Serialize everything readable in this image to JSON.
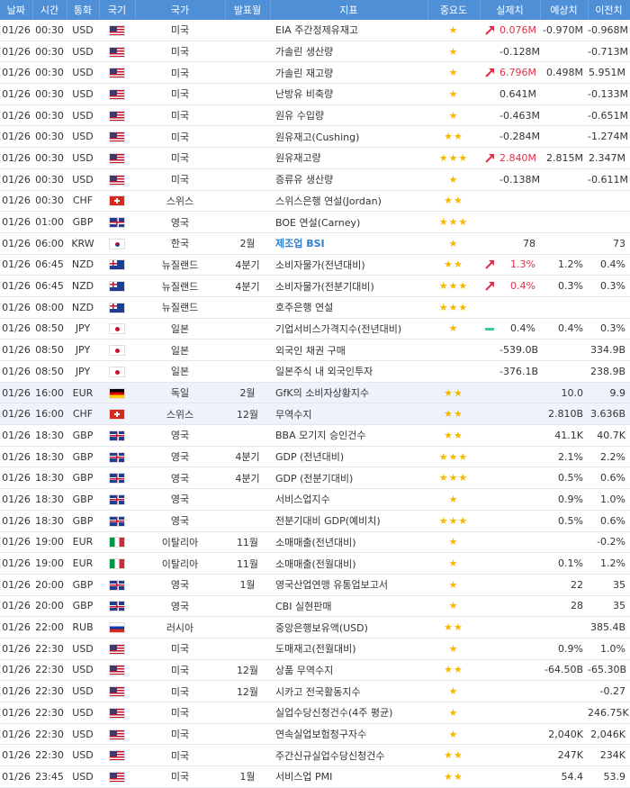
{
  "headers": {
    "date": "날짜",
    "time": "시간",
    "currency": "통화",
    "flag": "국기",
    "country": "국가",
    "period": "발표월",
    "indicator": "지표",
    "importance": "중요도",
    "actual": "실제치",
    "forecast": "예상치",
    "previous": "이전치"
  },
  "rows": [
    {
      "date": "01/26",
      "time": "00:30",
      "cur": "USD",
      "flag": "us",
      "country": "미국",
      "period": "",
      "name": "EIA 주간정제유재고",
      "stars": "★",
      "trend": "up",
      "actual": "0.076M",
      "actual_style": "red",
      "forecast": "-0.970M",
      "previous": "-0.968M"
    },
    {
      "date": "01/26",
      "time": "00:30",
      "cur": "USD",
      "flag": "us",
      "country": "미국",
      "period": "",
      "name": "가솔린 생산량",
      "stars": "★",
      "trend": "",
      "actual": "-0.128M",
      "actual_style": "",
      "forecast": "",
      "previous": "-0.713M"
    },
    {
      "date": "01/26",
      "time": "00:30",
      "cur": "USD",
      "flag": "us",
      "country": "미국",
      "period": "",
      "name": "가솔린 재고량",
      "stars": "★",
      "trend": "up",
      "actual": "6.796M",
      "actual_style": "red",
      "forecast": "0.498M",
      "previous": "5.951M"
    },
    {
      "date": "01/26",
      "time": "00:30",
      "cur": "USD",
      "flag": "us",
      "country": "미국",
      "period": "",
      "name": "난방유 비축량",
      "stars": "★",
      "trend": "",
      "actual": "0.641M",
      "actual_style": "",
      "forecast": "",
      "previous": "-0.133M"
    },
    {
      "date": "01/26",
      "time": "00:30",
      "cur": "USD",
      "flag": "us",
      "country": "미국",
      "period": "",
      "name": "원유 수입량",
      "stars": "★",
      "trend": "",
      "actual": "-0.463M",
      "actual_style": "",
      "forecast": "",
      "previous": "-0.651M"
    },
    {
      "date": "01/26",
      "time": "00:30",
      "cur": "USD",
      "flag": "us",
      "country": "미국",
      "period": "",
      "name": "원유재고(Cushing)",
      "stars": "★★",
      "trend": "",
      "actual": "-0.284M",
      "actual_style": "",
      "forecast": "",
      "previous": "-1.274M"
    },
    {
      "date": "01/26",
      "time": "00:30",
      "cur": "USD",
      "flag": "us",
      "country": "미국",
      "period": "",
      "name": "원유재고량",
      "stars": "★★★",
      "trend": "up",
      "actual": "2.840M",
      "actual_style": "red",
      "forecast": "2.815M",
      "previous": "2.347M"
    },
    {
      "date": "01/26",
      "time": "00:30",
      "cur": "USD",
      "flag": "us",
      "country": "미국",
      "period": "",
      "name": "증류유 생산량",
      "stars": "★",
      "trend": "",
      "actual": "-0.138M",
      "actual_style": "",
      "forecast": "",
      "previous": "-0.611M"
    },
    {
      "date": "01/26",
      "time": "00:30",
      "cur": "CHF",
      "flag": "ch",
      "country": "스위스",
      "period": "",
      "name": "스위스은행 연설(Jordan)",
      "stars": "★★",
      "trend": "",
      "actual": "",
      "actual_style": "",
      "forecast": "",
      "previous": ""
    },
    {
      "date": "01/26",
      "time": "01:00",
      "cur": "GBP",
      "flag": "gb",
      "country": "영국",
      "period": "",
      "name": "BOE 연설(Carney)",
      "stars": "★★★",
      "trend": "",
      "actual": "",
      "actual_style": "",
      "forecast": "",
      "previous": ""
    },
    {
      "date": "01/26",
      "time": "06:00",
      "cur": "KRW",
      "flag": "kr",
      "country": "한국",
      "period": "2월",
      "name": "제조업 BSI",
      "name_style": "blue",
      "stars": "★",
      "trend": "",
      "actual": "78",
      "actual_style": "",
      "forecast": "",
      "previous": "73"
    },
    {
      "date": "01/26",
      "time": "06:45",
      "cur": "NZD",
      "flag": "nz",
      "country": "뉴질랜드",
      "period": "4분기",
      "name": "소비자물가(전년대비)",
      "stars": "★★",
      "trend": "up",
      "actual": "1.3%",
      "actual_style": "red",
      "forecast": "1.2%",
      "previous": "0.4%"
    },
    {
      "date": "01/26",
      "time": "06:45",
      "cur": "NZD",
      "flag": "nz",
      "country": "뉴질랜드",
      "period": "4분기",
      "name": "소비자물가(전분기대비)",
      "stars": "★★★",
      "trend": "up",
      "actual": "0.4%",
      "actual_style": "red",
      "forecast": "0.3%",
      "previous": "0.3%"
    },
    {
      "date": "01/26",
      "time": "08:00",
      "cur": "NZD",
      "flag": "nz",
      "country": "뉴질랜드",
      "period": "",
      "name": "호주은행 연설",
      "stars": "★★★",
      "trend": "",
      "actual": "",
      "actual_style": "",
      "forecast": "",
      "previous": ""
    },
    {
      "date": "01/26",
      "time": "08:50",
      "cur": "JPY",
      "flag": "jp",
      "country": "일본",
      "period": "",
      "name": "기업서비스가격지수(전년대비)",
      "stars": "★",
      "trend": "flat",
      "actual": "0.4%",
      "actual_style": "",
      "forecast": "0.4%",
      "previous": "0.3%"
    },
    {
      "date": "01/26",
      "time": "08:50",
      "cur": "JPY",
      "flag": "jp",
      "country": "일본",
      "period": "",
      "name": "외국인 채권 구매",
      "stars": "",
      "trend": "",
      "actual": "-539.0B",
      "actual_style": "",
      "forecast": "",
      "previous": "334.9B"
    },
    {
      "date": "01/26",
      "time": "08:50",
      "cur": "JPY",
      "flag": "jp",
      "country": "일본",
      "period": "",
      "name": "일본주식 내 외국인투자",
      "stars": "",
      "trend": "",
      "actual": "-376.1B",
      "actual_style": "",
      "forecast": "",
      "previous": "238.9B"
    },
    {
      "date": "01/26",
      "time": "16:00",
      "cur": "EUR",
      "flag": "de",
      "country": "독일",
      "period": "2월",
      "name": "GfK의 소비자상황지수",
      "stars": "★★",
      "trend": "",
      "actual": "",
      "actual_style": "",
      "forecast": "10.0",
      "previous": "9.9",
      "highlight": true
    },
    {
      "date": "01/26",
      "time": "16:00",
      "cur": "CHF",
      "flag": "ch",
      "country": "스위스",
      "period": "12월",
      "name": "무역수지",
      "stars": "★★",
      "trend": "",
      "actual": "",
      "actual_style": "",
      "forecast": "2.810B",
      "previous": "3.636B",
      "highlight": true
    },
    {
      "date": "01/26",
      "time": "18:30",
      "cur": "GBP",
      "flag": "gb",
      "country": "영국",
      "period": "",
      "name": "BBA 모기지 승인건수",
      "stars": "★★",
      "trend": "",
      "actual": "",
      "actual_style": "",
      "forecast": "41.1K",
      "previous": "40.7K"
    },
    {
      "date": "01/26",
      "time": "18:30",
      "cur": "GBP",
      "flag": "gb",
      "country": "영국",
      "period": "4분기",
      "name": "GDP (전년대비)",
      "stars": "★★★",
      "trend": "",
      "actual": "",
      "actual_style": "",
      "forecast": "2.1%",
      "previous": "2.2%"
    },
    {
      "date": "01/26",
      "time": "18:30",
      "cur": "GBP",
      "flag": "gb",
      "country": "영국",
      "period": "4분기",
      "name": "GDP (전분기대비)",
      "stars": "★★★",
      "trend": "",
      "actual": "",
      "actual_style": "",
      "forecast": "0.5%",
      "previous": "0.6%"
    },
    {
      "date": "01/26",
      "time": "18:30",
      "cur": "GBP",
      "flag": "gb",
      "country": "영국",
      "period": "",
      "name": "서비스업지수",
      "stars": "★",
      "trend": "",
      "actual": "",
      "actual_style": "",
      "forecast": "0.9%",
      "previous": "1.0%"
    },
    {
      "date": "01/26",
      "time": "18:30",
      "cur": "GBP",
      "flag": "gb",
      "country": "영국",
      "period": "",
      "name": "전분기대비 GDP(예비치)",
      "stars": "★★★",
      "trend": "",
      "actual": "",
      "actual_style": "",
      "forecast": "0.5%",
      "previous": "0.6%"
    },
    {
      "date": "01/26",
      "time": "19:00",
      "cur": "EUR",
      "flag": "it",
      "country": "이탈리아",
      "period": "11월",
      "name": "소매매출(전년대비)",
      "stars": "★",
      "trend": "",
      "actual": "",
      "actual_style": "",
      "forecast": "",
      "previous": "-0.2%"
    },
    {
      "date": "01/26",
      "time": "19:00",
      "cur": "EUR",
      "flag": "it",
      "country": "이탈리아",
      "period": "11월",
      "name": "소매매출(전월대비)",
      "stars": "★",
      "trend": "",
      "actual": "",
      "actual_style": "",
      "forecast": "0.1%",
      "previous": "1.2%"
    },
    {
      "date": "01/26",
      "time": "20:00",
      "cur": "GBP",
      "flag": "gb",
      "country": "영국",
      "period": "1월",
      "name": "영국산업연맹 유통업보고서",
      "stars": "★",
      "trend": "",
      "actual": "",
      "actual_style": "",
      "forecast": "22",
      "previous": "35"
    },
    {
      "date": "01/26",
      "time": "20:00",
      "cur": "GBP",
      "flag": "gb",
      "country": "영국",
      "period": "",
      "name": "CBI 실현판매",
      "stars": "★",
      "trend": "",
      "actual": "",
      "actual_style": "",
      "forecast": "28",
      "previous": "35"
    },
    {
      "date": "01/26",
      "time": "22:00",
      "cur": "RUB",
      "flag": "ru",
      "country": "러시아",
      "period": "",
      "name": "중앙은행보유액(USD)",
      "stars": "★★",
      "trend": "",
      "actual": "",
      "actual_style": "",
      "forecast": "",
      "previous": "385.4B"
    },
    {
      "date": "01/26",
      "time": "22:30",
      "cur": "USD",
      "flag": "us",
      "country": "미국",
      "period": "",
      "name": "도매재고(전월대비)",
      "stars": "★",
      "trend": "",
      "actual": "",
      "actual_style": "",
      "forecast": "0.9%",
      "previous": "1.0%"
    },
    {
      "date": "01/26",
      "time": "22:30",
      "cur": "USD",
      "flag": "us",
      "country": "미국",
      "period": "12월",
      "name": "상품 무역수지",
      "stars": "★★",
      "trend": "",
      "actual": "",
      "actual_style": "",
      "forecast": "-64.50B",
      "previous": "-65.30B"
    },
    {
      "date": "01/26",
      "time": "22:30",
      "cur": "USD",
      "flag": "us",
      "country": "미국",
      "period": "12월",
      "name": "시카고 전국활동지수",
      "stars": "★",
      "trend": "",
      "actual": "",
      "actual_style": "",
      "forecast": "",
      "previous": "-0.27"
    },
    {
      "date": "01/26",
      "time": "22:30",
      "cur": "USD",
      "flag": "us",
      "country": "미국",
      "period": "",
      "name": "실업수당신청건수(4주 평균)",
      "stars": "★",
      "trend": "",
      "actual": "",
      "actual_style": "",
      "forecast": "",
      "previous": "246.75K"
    },
    {
      "date": "01/26",
      "time": "22:30",
      "cur": "USD",
      "flag": "us",
      "country": "미국",
      "period": "",
      "name": "연속실업보험청구자수",
      "stars": "★",
      "trend": "",
      "actual": "",
      "actual_style": "",
      "forecast": "2,040K",
      "previous": "2,046K"
    },
    {
      "date": "01/26",
      "time": "22:30",
      "cur": "USD",
      "flag": "us",
      "country": "미국",
      "period": "",
      "name": "주간신규실업수당신청건수",
      "stars": "★★",
      "trend": "",
      "actual": "",
      "actual_style": "",
      "forecast": "247K",
      "previous": "234K"
    },
    {
      "date": "01/26",
      "time": "23:45",
      "cur": "USD",
      "flag": "us",
      "country": "미국",
      "period": "1월",
      "name": "서비스업 PMI",
      "stars": "★★",
      "trend": "",
      "actual": "",
      "actual_style": "",
      "forecast": "54.4",
      "previous": "53.9"
    }
  ]
}
